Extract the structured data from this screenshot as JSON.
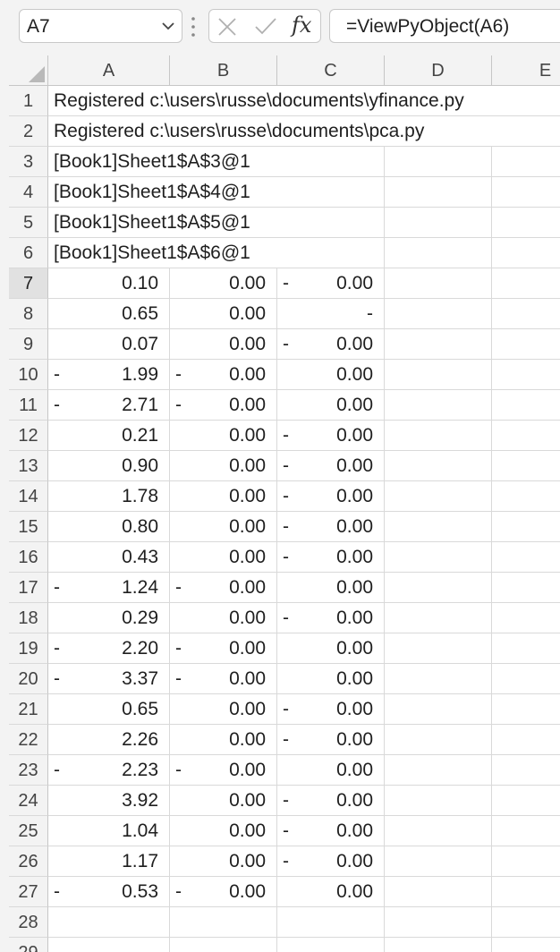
{
  "name_box": {
    "value": "A7"
  },
  "formula_bar": {
    "fx": "fx",
    "formula": "=ViewPyObject(A6)"
  },
  "columns": [
    "A",
    "B",
    "C",
    "D",
    "E"
  ],
  "text_rows": [
    {
      "row": "1",
      "text": "Registered c:\\users\\russe\\documents\\yfinance.py"
    },
    {
      "row": "2",
      "text": "Registered c:\\users\\russe\\documents\\pca.py"
    },
    {
      "row": "3",
      "text": "[Book1]Sheet1$A$3@1"
    },
    {
      "row": "4",
      "text": "[Book1]Sheet1$A$4@1"
    },
    {
      "row": "5",
      "text": "[Book1]Sheet1$A$5@1"
    },
    {
      "row": "6",
      "text": "[Book1]Sheet1$A$6@1"
    }
  ],
  "data_rows": [
    {
      "row": "7",
      "a_neg": "",
      "a": "0.10",
      "b_neg": "",
      "b": "0.00",
      "c_neg": "-",
      "c": "0.00"
    },
    {
      "row": "8",
      "a_neg": "",
      "a": "0.65",
      "b_neg": "",
      "b": "0.00",
      "c_neg": "",
      "c": "-"
    },
    {
      "row": "9",
      "a_neg": "",
      "a": "0.07",
      "b_neg": "",
      "b": "0.00",
      "c_neg": "-",
      "c": "0.00"
    },
    {
      "row": "10",
      "a_neg": "-",
      "a": "1.99",
      "b_neg": "-",
      "b": "0.00",
      "c_neg": "",
      "c": "0.00"
    },
    {
      "row": "11",
      "a_neg": "-",
      "a": "2.71",
      "b_neg": "-",
      "b": "0.00",
      "c_neg": "",
      "c": "0.00"
    },
    {
      "row": "12",
      "a_neg": "",
      "a": "0.21",
      "b_neg": "",
      "b": "0.00",
      "c_neg": "-",
      "c": "0.00"
    },
    {
      "row": "13",
      "a_neg": "",
      "a": "0.90",
      "b_neg": "",
      "b": "0.00",
      "c_neg": "-",
      "c": "0.00"
    },
    {
      "row": "14",
      "a_neg": "",
      "a": "1.78",
      "b_neg": "",
      "b": "0.00",
      "c_neg": "-",
      "c": "0.00"
    },
    {
      "row": "15",
      "a_neg": "",
      "a": "0.80",
      "b_neg": "",
      "b": "0.00",
      "c_neg": "-",
      "c": "0.00"
    },
    {
      "row": "16",
      "a_neg": "",
      "a": "0.43",
      "b_neg": "",
      "b": "0.00",
      "c_neg": "-",
      "c": "0.00"
    },
    {
      "row": "17",
      "a_neg": "-",
      "a": "1.24",
      "b_neg": "-",
      "b": "0.00",
      "c_neg": "",
      "c": "0.00"
    },
    {
      "row": "18",
      "a_neg": "",
      "a": "0.29",
      "b_neg": "",
      "b": "0.00",
      "c_neg": "-",
      "c": "0.00"
    },
    {
      "row": "19",
      "a_neg": "-",
      "a": "2.20",
      "b_neg": "-",
      "b": "0.00",
      "c_neg": "",
      "c": "0.00"
    },
    {
      "row": "20",
      "a_neg": "-",
      "a": "3.37",
      "b_neg": "-",
      "b": "0.00",
      "c_neg": "",
      "c": "0.00"
    },
    {
      "row": "21",
      "a_neg": "",
      "a": "0.65",
      "b_neg": "",
      "b": "0.00",
      "c_neg": "-",
      "c": "0.00"
    },
    {
      "row": "22",
      "a_neg": "",
      "a": "2.26",
      "b_neg": "",
      "b": "0.00",
      "c_neg": "-",
      "c": "0.00"
    },
    {
      "row": "23",
      "a_neg": "-",
      "a": "2.23",
      "b_neg": "-",
      "b": "0.00",
      "c_neg": "",
      "c": "0.00"
    },
    {
      "row": "24",
      "a_neg": "",
      "a": "3.92",
      "b_neg": "",
      "b": "0.00",
      "c_neg": "-",
      "c": "0.00"
    },
    {
      "row": "25",
      "a_neg": "",
      "a": "1.04",
      "b_neg": "",
      "b": "0.00",
      "c_neg": "-",
      "c": "0.00"
    },
    {
      "row": "26",
      "a_neg": "",
      "a": "1.17",
      "b_neg": "",
      "b": "0.00",
      "c_neg": "-",
      "c": "0.00"
    },
    {
      "row": "27",
      "a_neg": "-",
      "a": "0.53",
      "b_neg": "-",
      "b": "0.00",
      "c_neg": "",
      "c": "0.00"
    }
  ],
  "empty_rows": [
    "28",
    "29"
  ],
  "selected_row": "7"
}
